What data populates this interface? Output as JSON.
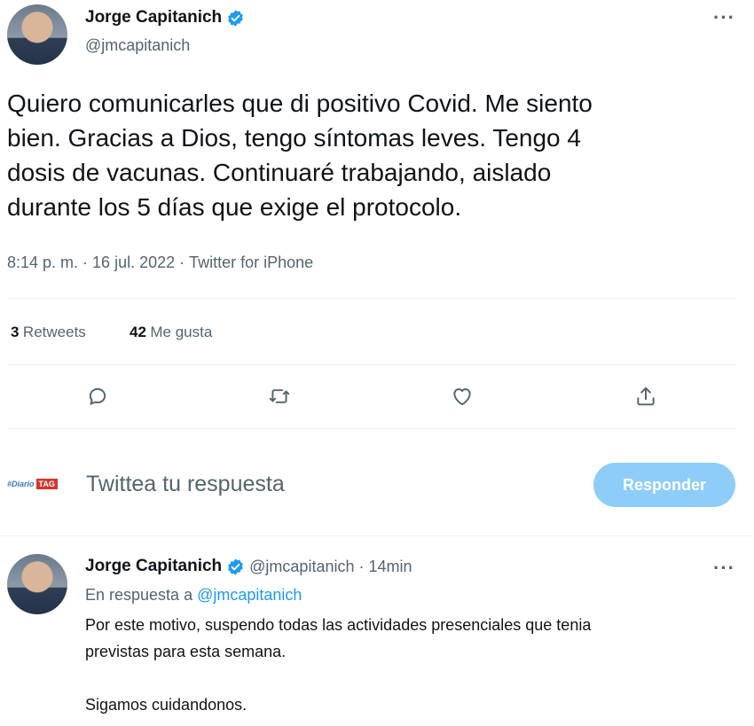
{
  "main_tweet": {
    "author_name": "Jorge Capitanich",
    "handle": "@jmcapitanich",
    "text_lines": [
      "Quiero comunicarles que di positivo Covid. Me siento",
      "bien. Gracias a Dios, tengo síntomas leves. Tengo 4",
      "dosis de vacunas. Continuaré trabajando, aislado",
      "durante los 5 días que exige el protocolo."
    ],
    "time": "8:14 p. m.",
    "date": "16 jul. 2022",
    "source": "Twitter for iPhone",
    "separator": "·",
    "retweets_count": "3",
    "retweets_label": "Retweets",
    "likes_count": "42",
    "likes_label": "Me gusta",
    "more_label": "···"
  },
  "actions": {
    "reply_icon": "reply-icon",
    "retweet_icon": "retweet-icon",
    "like_icon": "heart-icon",
    "share_icon": "share-icon"
  },
  "composer": {
    "logo_text": "#Diario",
    "logo_tag": "TAG",
    "placeholder": "Twittea tu respuesta",
    "button_label": "Responder"
  },
  "reply_tweet": {
    "author_name": "Jorge Capitanich",
    "handle": "@jmcapitanich",
    "separator": "·",
    "time_ago": "14min",
    "in_reply_prefix": "En respuesta a",
    "in_reply_handle": "@jmcapitanich",
    "line1": "Por este motivo, suspendo todas las actividades presenciales que tenia",
    "line2": "previstas para esta semana.",
    "line3": "Sigamos cuidandonos.",
    "more_label": "···"
  },
  "colors": {
    "verified": "#1d9bf0",
    "button": "#8ecdf8",
    "link": "#1d9bf0"
  }
}
